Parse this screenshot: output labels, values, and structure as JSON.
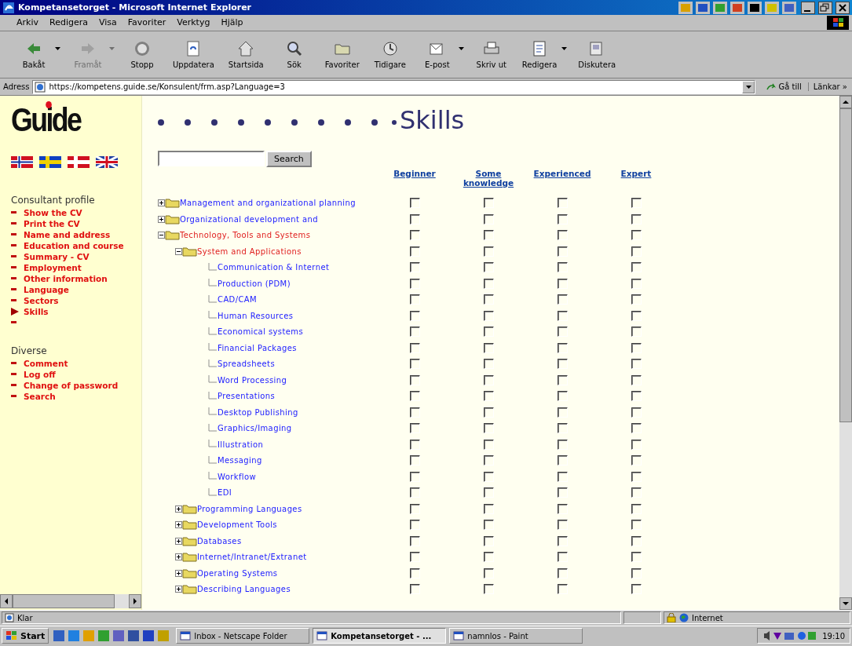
{
  "window": {
    "title": "Kompetansetorget - Microsoft Internet Explorer"
  },
  "menu": [
    {
      "label": "Arkiv"
    },
    {
      "label": "Redigera"
    },
    {
      "label": "Visa"
    },
    {
      "label": "Favoriter"
    },
    {
      "label": "Verktyg"
    },
    {
      "label": "Hjälp"
    }
  ],
  "toolbar": [
    {
      "label": "Bakåt",
      "disabled": false,
      "dropdown": true
    },
    {
      "label": "Framåt",
      "disabled": true,
      "dropdown": true
    },
    {
      "label": "Stopp",
      "disabled": false,
      "dropdown": false
    },
    {
      "label": "Uppdatera",
      "disabled": false,
      "dropdown": false
    },
    {
      "label": "Startsida",
      "disabled": false,
      "dropdown": false
    },
    {
      "label": "Sök",
      "disabled": false,
      "dropdown": false
    },
    {
      "label": "Favoriter",
      "disabled": false,
      "dropdown": false
    },
    {
      "label": "Tidigare",
      "disabled": false,
      "dropdown": false
    },
    {
      "label": "E-post",
      "disabled": false,
      "dropdown": true
    },
    {
      "label": "Skriv ut",
      "disabled": false,
      "dropdown": false
    },
    {
      "label": "Redigera",
      "disabled": false,
      "dropdown": true
    },
    {
      "label": "Diskutera",
      "disabled": false,
      "dropdown": false
    }
  ],
  "address": {
    "label": "Adress",
    "url": "https://kompetens.guide.se/Konsulent/frm.asp?Language=3",
    "go": "Gå till",
    "links": "Länkar »"
  },
  "sidebar": {
    "logo": "Guide",
    "sections": [
      {
        "title": "Consultant profile",
        "trailing_bullet": true,
        "items": [
          {
            "label": "Show the CV",
            "selected": false
          },
          {
            "label": "Print the CV",
            "selected": false
          },
          {
            "label": "Name and address",
            "selected": false
          },
          {
            "label": "Education and course",
            "selected": false
          },
          {
            "label": "Summary - CV",
            "selected": false
          },
          {
            "label": "Employment",
            "selected": false
          },
          {
            "label": "Other information",
            "selected": false
          },
          {
            "label": "Language",
            "selected": false
          },
          {
            "label": "Sectors",
            "selected": false
          },
          {
            "label": "Skills",
            "selected": true
          }
        ]
      },
      {
        "title": "Diverse",
        "trailing_bullet": false,
        "items": [
          {
            "label": "Comment",
            "selected": false
          },
          {
            "label": "Log off",
            "selected": false
          },
          {
            "label": "Change of password",
            "selected": false
          },
          {
            "label": "Search",
            "selected": false
          }
        ]
      }
    ]
  },
  "main": {
    "heading": "Skills",
    "search": {
      "button": "Search"
    },
    "columns": [
      "Beginner",
      "Some knowledge",
      "Experienced",
      "Expert"
    ],
    "tree": [
      {
        "label": "Management and organizational planning",
        "expanded": false,
        "checked": [
          false,
          false,
          false,
          false
        ]
      },
      {
        "label": "Organizational development and",
        "expanded": false,
        "checked": [
          false,
          false,
          false,
          false
        ]
      },
      {
        "label": "Technology, Tools and Systems",
        "expanded": true,
        "checked": [
          false,
          false,
          false,
          false
        ],
        "children": [
          {
            "label": "System and Applications",
            "expanded": true,
            "checked": [
              false,
              false,
              false,
              false
            ],
            "children": [
              {
                "label": "Communication & Internet",
                "checked": [
                  false,
                  false,
                  false,
                  false
                ]
              },
              {
                "label": "Production (PDM)",
                "checked": [
                  false,
                  false,
                  false,
                  false
                ]
              },
              {
                "label": "CAD/CAM",
                "checked": [
                  false,
                  false,
                  false,
                  false
                ]
              },
              {
                "label": "Human Resources",
                "checked": [
                  false,
                  false,
                  false,
                  false
                ]
              },
              {
                "label": "Economical systems",
                "checked": [
                  false,
                  false,
                  false,
                  false
                ]
              },
              {
                "label": "Financial Packages",
                "checked": [
                  false,
                  false,
                  false,
                  false
                ]
              },
              {
                "label": "Spreadsheets",
                "checked": [
                  false,
                  false,
                  false,
                  false
                ]
              },
              {
                "label": "Word Processing",
                "checked": [
                  false,
                  false,
                  false,
                  false
                ]
              },
              {
                "label": "Presentations",
                "checked": [
                  false,
                  false,
                  false,
                  false
                ]
              },
              {
                "label": "Desktop Publishing",
                "checked": [
                  false,
                  false,
                  false,
                  false
                ]
              },
              {
                "label": "Graphics/Imaging",
                "checked": [
                  false,
                  false,
                  false,
                  false
                ]
              },
              {
                "label": "Illustration",
                "checked": [
                  false,
                  false,
                  false,
                  false
                ]
              },
              {
                "label": "Messaging",
                "checked": [
                  false,
                  false,
                  false,
                  false
                ]
              },
              {
                "label": "Workflow",
                "checked": [
                  false,
                  false,
                  false,
                  false
                ]
              },
              {
                "label": "EDI",
                "checked": [
                  false,
                  false,
                  false,
                  false
                ]
              }
            ]
          },
          {
            "label": "Programming Languages",
            "expanded": false,
            "checked": [
              false,
              false,
              false,
              false
            ]
          },
          {
            "label": "Development Tools",
            "expanded": false,
            "checked": [
              false,
              false,
              false,
              false
            ]
          },
          {
            "label": "Databases",
            "expanded": false,
            "checked": [
              false,
              false,
              false,
              false
            ]
          },
          {
            "label": "Internet/Intranet/Extranet",
            "expanded": false,
            "checked": [
              false,
              false,
              false,
              false
            ]
          },
          {
            "label": "Operating Systems",
            "expanded": false,
            "checked": [
              false,
              false,
              false,
              false
            ]
          },
          {
            "label": "Describing Languages",
            "expanded": false,
            "checked": [
              false,
              false,
              false,
              false
            ]
          }
        ]
      }
    ]
  },
  "status_bar": {
    "text": "Klar",
    "zone": "Internet"
  },
  "taskbar": {
    "start": "Start",
    "tasks": [
      {
        "label": "Inbox - Netscape Folder",
        "selected": false
      },
      {
        "label": "Kompetansetorget - ...",
        "selected": true
      },
      {
        "label": "namnlos - Paint",
        "selected": false
      }
    ],
    "clock": "19:10"
  }
}
